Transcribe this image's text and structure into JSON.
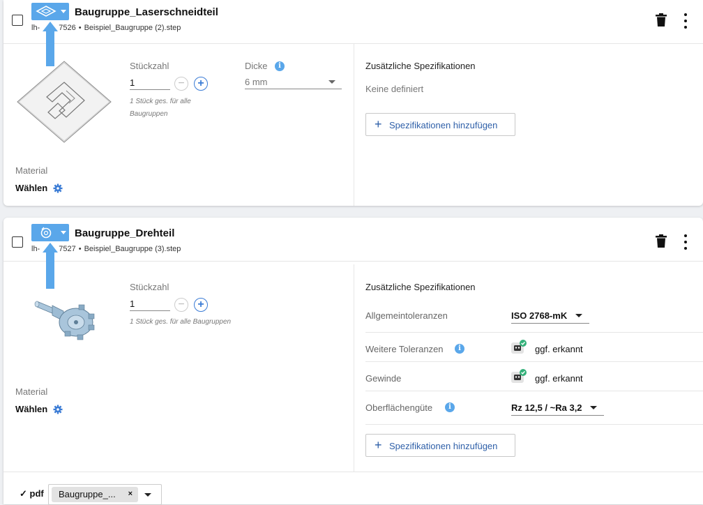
{
  "parts": [
    {
      "title": "Baugruppe_Laserschneidteil",
      "id_prefix": "lh-",
      "id_suffix": "7526",
      "file": "Beispiel_Baugruppe (2).step",
      "type_icon": "laser-sheet-icon",
      "quantity_label": "Stückzahl",
      "quantity_value": "1",
      "quantity_hint_line1": "1 Stück ges. für alle",
      "quantity_hint_line2": "Baugruppen",
      "thickness_label": "Dicke",
      "thickness_value": "6 mm",
      "specs_title": "Zusätzliche Spezifikationen",
      "specs_none": "Keine definiert",
      "add_specs_label": "Spezifikationen hinzufügen",
      "material_label": "Material",
      "material_value": "Wählen"
    },
    {
      "title": "Baugruppe_Drehteil",
      "id_prefix": "lh-",
      "id_suffix": "7527",
      "file": "Beispiel_Baugruppe (3).step",
      "type_icon": "turning-part-icon",
      "quantity_label": "Stückzahl",
      "quantity_value": "1",
      "quantity_hint": "1 Stück ges. für alle Baugruppen",
      "specs_title": "Zusätzliche Spezifikationen",
      "spec_rows": [
        {
          "label": "Allgemeintoleranzen",
          "value": "ISO 2768-mK"
        },
        {
          "label": "Weitere Toleranzen",
          "value": "ggf. erkannt"
        },
        {
          "label": "Gewinde",
          "value": "ggf. erkannt"
        },
        {
          "label": "Oberflächengüte",
          "value": "Rz 12,5 / ~Ra 3,2"
        }
      ],
      "add_specs_label": "Spezifikationen hinzufügen",
      "material_label": "Material",
      "material_value": "Wählen"
    }
  ],
  "footer": {
    "check": "✓",
    "pdf_label": "pdf",
    "chip_text": "Baugruppe_...",
    "chip_remove": "×"
  },
  "colors": {
    "accent": "#5aa7ea",
    "link": "#2e5fa8",
    "detected_check": "#34b07a"
  }
}
